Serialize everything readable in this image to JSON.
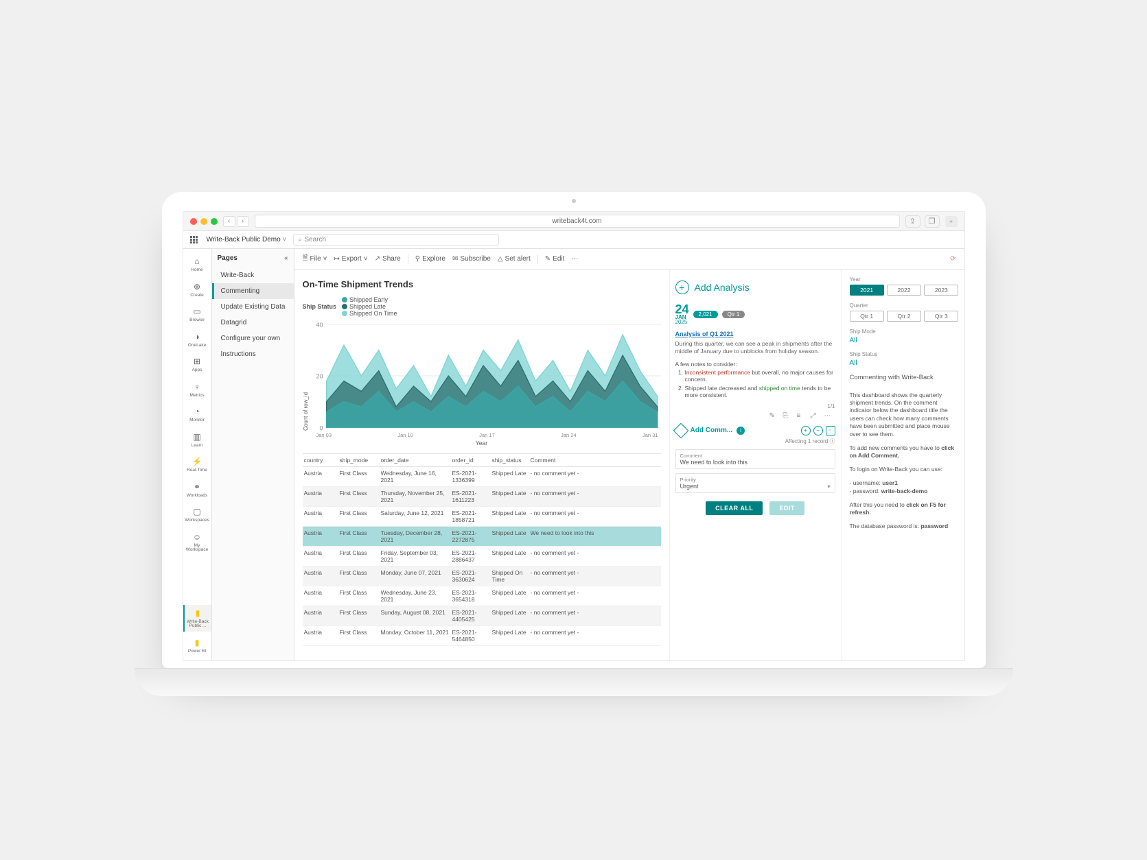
{
  "browser": {
    "url": "writeback4t.com"
  },
  "pbi": {
    "workspace": "Write-Back Public Demo",
    "search_placeholder": "Search"
  },
  "rail": [
    {
      "id": "home",
      "label": "Home",
      "icon": "⌂"
    },
    {
      "id": "create",
      "label": "Create",
      "icon": "⊕"
    },
    {
      "id": "browse",
      "label": "Browse",
      "icon": "▭"
    },
    {
      "id": "onelake",
      "label": "OneLake",
      "icon": "◑"
    },
    {
      "id": "apps",
      "label": "Apps",
      "icon": "⊞"
    },
    {
      "id": "metrics",
      "label": "Metrics",
      "icon": "♀"
    },
    {
      "id": "monitor",
      "label": "Monitor",
      "icon": "◔"
    },
    {
      "id": "learn",
      "label": "Learn",
      "icon": "▥"
    },
    {
      "id": "realtime",
      "label": "Real-Time",
      "icon": "⚡"
    },
    {
      "id": "workloads",
      "label": "Workloads",
      "icon": "⚭"
    },
    {
      "id": "workspaces",
      "label": "Workspaces",
      "icon": "▢"
    },
    {
      "id": "myws",
      "label": "My Workspace",
      "icon": "☺"
    }
  ],
  "rail_bottom": {
    "id": "wbpublic",
    "label": "Write-Back Public ...",
    "icon": "▮"
  },
  "rail_powerbi": {
    "label": "Power BI"
  },
  "pages": {
    "title": "Pages",
    "items": [
      {
        "label": "Write-Back",
        "active": false
      },
      {
        "label": "Commenting",
        "active": true
      },
      {
        "label": "Update Existing Data",
        "active": false
      },
      {
        "label": "Datagrid",
        "active": false
      },
      {
        "label": "Configure your own",
        "active": false
      },
      {
        "label": "Instructions",
        "active": false
      }
    ]
  },
  "toolbar": {
    "file": "File",
    "export": "Export",
    "share": "Share",
    "explore": "Explore",
    "subscribe": "Subscribe",
    "setalert": "Set alert",
    "edit": "Edit"
  },
  "report": {
    "title": "On-Time Shipment Trends",
    "legend_label": "Ship Status",
    "legend": [
      {
        "label": "Shipped Early",
        "color": "#3aa7a7"
      },
      {
        "label": "Shipped Late",
        "color": "#2b6e6e"
      },
      {
        "label": "Shipped On Time",
        "color": "#7fd3d3"
      }
    ]
  },
  "chart_data": {
    "type": "area",
    "title": "",
    "ylabel": "Count of row_id",
    "xlabel": "Year",
    "ylim": [
      0,
      40
    ],
    "x": [
      "Jan 03",
      "Jan 10",
      "Jan 17",
      "Jan 24",
      "Jan 31"
    ],
    "series": [
      {
        "name": "Shipped Early",
        "color": "#7fd3d3",
        "values": [
          18,
          32,
          20,
          30,
          15,
          24,
          12,
          28,
          16,
          30,
          22,
          34,
          18,
          26,
          14,
          30,
          20,
          36,
          22,
          12
        ]
      },
      {
        "name": "Shipped Late",
        "color": "#2b6e6e",
        "values": [
          10,
          18,
          14,
          22,
          8,
          16,
          10,
          20,
          12,
          24,
          16,
          26,
          12,
          18,
          10,
          22,
          14,
          28,
          16,
          8
        ]
      },
      {
        "name": "Shipped On Time",
        "color": "#3aa7a7",
        "values": [
          6,
          10,
          8,
          14,
          6,
          10,
          6,
          12,
          8,
          14,
          10,
          16,
          8,
          12,
          6,
          14,
          10,
          18,
          10,
          6
        ]
      }
    ]
  },
  "table": {
    "headers": [
      "country",
      "ship_mode",
      "order_date",
      "order_id",
      "ship_status",
      "Comment"
    ],
    "rows": [
      {
        "country": "Austria",
        "ship_mode": "First Class",
        "order_date": "Wednesday, June 16, 2021",
        "order_id": "ES-2021-1336399",
        "ship_status": "Shipped Late",
        "comment": "- no comment yet -",
        "alt": false,
        "hl": false
      },
      {
        "country": "Austria",
        "ship_mode": "First Class",
        "order_date": "Thursday, November 25, 2021",
        "order_id": "ES-2021-1611223",
        "ship_status": "Shipped Late",
        "comment": "- no comment yet -",
        "alt": true,
        "hl": false
      },
      {
        "country": "Austria",
        "ship_mode": "First Class",
        "order_date": "Saturday, June 12, 2021",
        "order_id": "ES-2021-1858721",
        "ship_status": "Shipped Late",
        "comment": "- no comment yet -",
        "alt": false,
        "hl": false
      },
      {
        "country": "Austria",
        "ship_mode": "First Class",
        "order_date": "Tuesday, December 28, 2021",
        "order_id": "ES-2021-2272875",
        "ship_status": "Shipped Late",
        "comment": "We need to look into this",
        "alt": false,
        "hl": true
      },
      {
        "country": "Austria",
        "ship_mode": "First Class",
        "order_date": "Friday, September 03, 2021",
        "order_id": "ES-2021-2886437",
        "ship_status": "Shipped Late",
        "comment": "- no comment yet -",
        "alt": false,
        "hl": false
      },
      {
        "country": "Austria",
        "ship_mode": "First Class",
        "order_date": "Monday, June 07, 2021",
        "order_id": "ES-2021-3630624",
        "ship_status": "Shipped On Time",
        "comment": "- no comment yet -",
        "alt": true,
        "hl": false
      },
      {
        "country": "Austria",
        "ship_mode": "First Class",
        "order_date": "Wednesday, June 23, 2021",
        "order_id": "ES-2021-3654318",
        "ship_status": "Shipped Late",
        "comment": "- no comment yet -",
        "alt": false,
        "hl": false
      },
      {
        "country": "Austria",
        "ship_mode": "First Class",
        "order_date": "Sunday, August 08, 2021",
        "order_id": "ES-2021-4405425",
        "ship_status": "Shipped Late",
        "comment": "- no comment yet -",
        "alt": true,
        "hl": false
      },
      {
        "country": "Austria",
        "ship_mode": "First Class",
        "order_date": "Monday, October 11, 2021",
        "order_id": "ES-2021-5464850",
        "ship_status": "Shipped Late",
        "comment": "- no comment yet -",
        "alt": false,
        "hl": false
      }
    ]
  },
  "analysis": {
    "add_label": "Add Analysis",
    "day": "24",
    "month": "JAN",
    "year": "2025",
    "chip_year": "2,021",
    "chip_q": "Qtr 1",
    "link": "Analysis of Q1 2021",
    "body": "During this quarter, we can see a peak in shipments after the middle of January due to unblocks from holiday season.",
    "notes_intro": "A few notes to consider:",
    "note1a": "Inconsistent performance",
    "note1b": " but overall, no major causes for concern.",
    "note2a": "Shipped late decreased and ",
    "note2b": "shipped on time",
    "note2c": " tends to be more consistent.",
    "pager": "1/1",
    "add_comment": "Add Comm...",
    "affecting": "Affecting 1 record",
    "comment_label": "Comment",
    "comment_val": "We need to look into this",
    "priority_label": "Priority",
    "priority_val": "Urgent",
    "btn_clear": "CLEAR ALL",
    "btn_edit": "EDIT"
  },
  "slicers": {
    "year_label": "Year",
    "years": [
      {
        "v": "2021",
        "on": true
      },
      {
        "v": "2022",
        "on": false
      },
      {
        "v": "2023",
        "on": false
      }
    ],
    "quarter_label": "Quarter",
    "quarters": [
      {
        "v": "Qtr 1",
        "on": false
      },
      {
        "v": "Qtr 2",
        "on": false
      },
      {
        "v": "Qtr 3",
        "on": false
      }
    ],
    "shipmode_label": "Ship Mode",
    "shipmode_val": "All",
    "shipstatus_label": "Ship Status",
    "shipstatus_val": "All"
  },
  "help": {
    "title": "Commenting with Write-Back",
    "p1": "This dashboard shows the quarterly shipment trends. On the comment indicator below the dashboard title the users can check how many comments have been submitted and place mouse over to see them.",
    "p2a": "To add new comments you have to ",
    "p2b": "click on Add Comment.",
    "p3": "To login on Write-Back you can use:",
    "user_l": "- username: ",
    "user_v": "user1",
    "pass_l": "- password: ",
    "pass_v": "write-back-demo",
    "p4a": "After this you need to ",
    "p4b": "click on F5 for refresh.",
    "p5a": "The database password is: ",
    "p5b": "password"
  }
}
